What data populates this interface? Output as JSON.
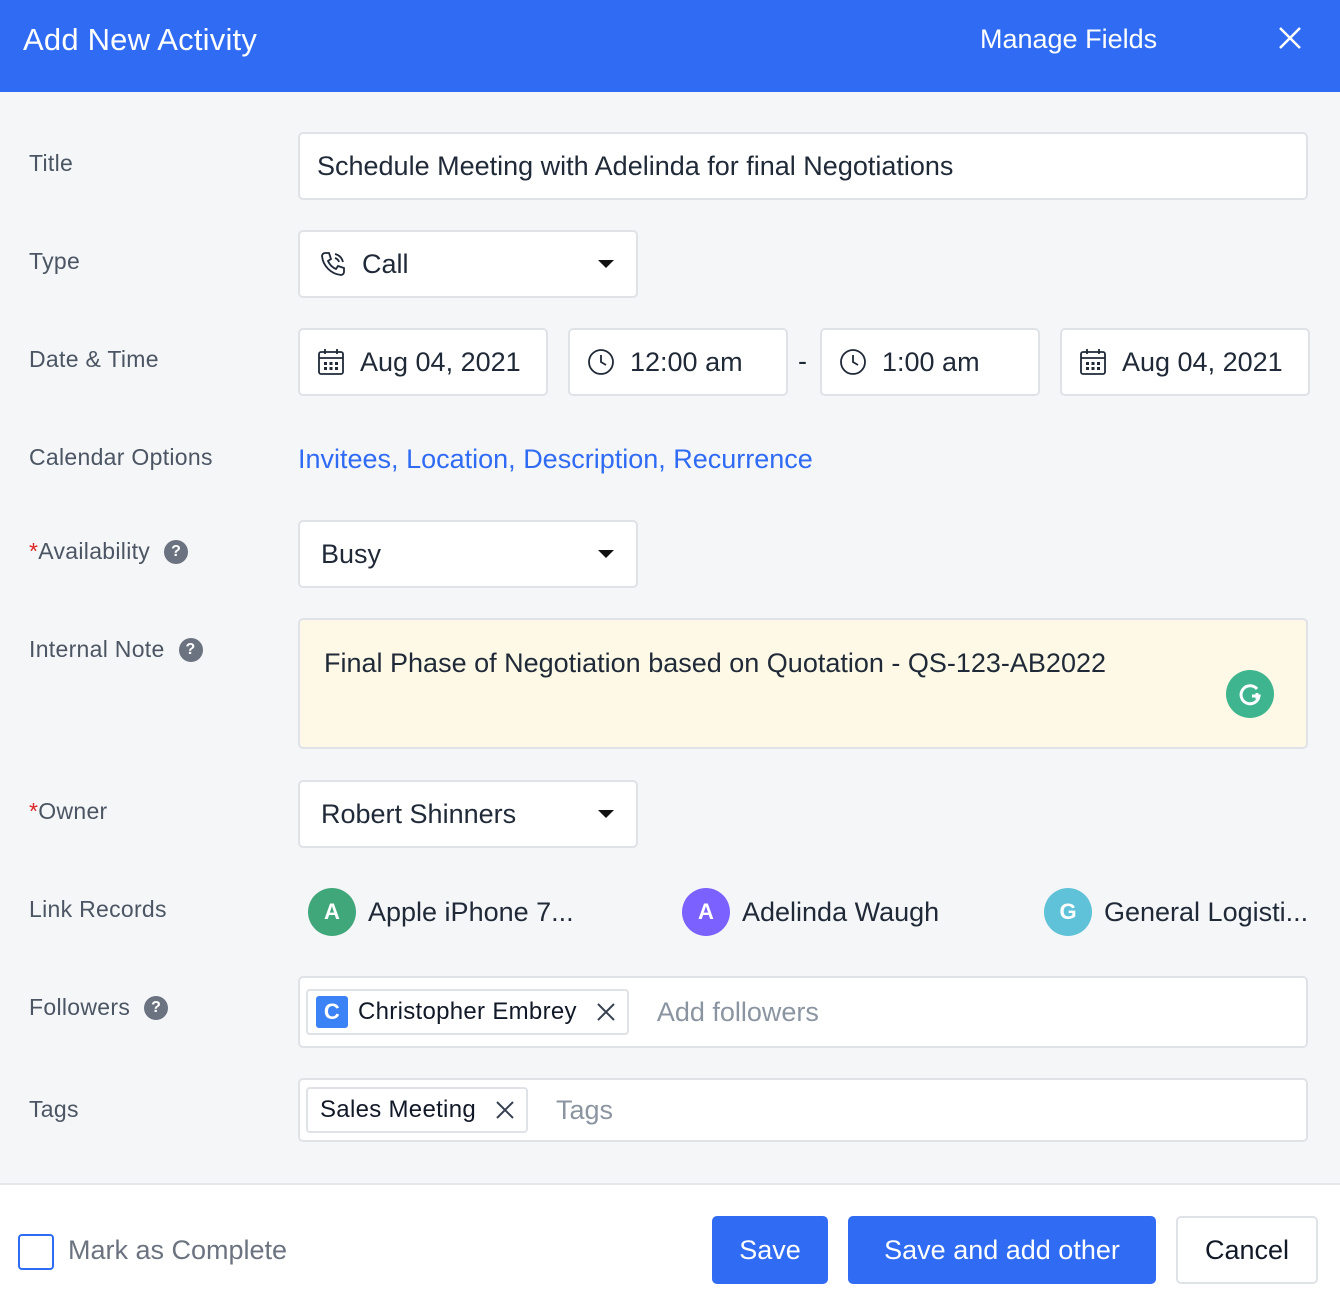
{
  "header": {
    "title": "Add New Activity",
    "manage_fields": "Manage Fields"
  },
  "form": {
    "title": {
      "label": "Title",
      "value": "Schedule Meeting with Adelinda for final Negotiations"
    },
    "type": {
      "label": "Type",
      "value": "Call"
    },
    "datetime": {
      "label": "Date & Time",
      "start_date": "Aug 04, 2021",
      "start_time": "12:00 am",
      "separator": "-",
      "end_time": "1:00 am",
      "end_date": "Aug 04, 2021"
    },
    "calendar_options": {
      "label": "Calendar Options",
      "links": [
        "Invitees,",
        "Location,",
        "Description,",
        "Recurrence"
      ]
    },
    "availability": {
      "required_mark": "*",
      "label": "Availability",
      "value": "Busy",
      "help": "?"
    },
    "internal_note": {
      "label": "Internal Note",
      "value": "Final Phase of Negotiation based on Quotation - QS-123-AB2022",
      "help": "?"
    },
    "owner": {
      "required_mark": "*",
      "label": "Owner",
      "value": "Robert Shinners"
    },
    "link_records": {
      "label": "Link Records",
      "items": [
        {
          "initial": "A",
          "name": "Apple iPhone 7...",
          "color": "#3fa77a"
        },
        {
          "initial": "A",
          "name": "Adelinda Waugh",
          "color": "#7b61ff"
        },
        {
          "initial": "G",
          "name": "General Logisti...",
          "color": "#5fc2d9"
        }
      ]
    },
    "followers": {
      "label": "Followers",
      "help": "?",
      "chip_initial": "C",
      "chip_name": "Christopher Embrey",
      "placeholder": "Add followers"
    },
    "tags": {
      "label": "Tags",
      "chip_name": "Sales Meeting",
      "placeholder": "Tags"
    }
  },
  "footer": {
    "mark_complete": "Mark as Complete",
    "save": "Save",
    "save_add_other": "Save and add other",
    "cancel": "Cancel"
  },
  "colors": {
    "accent": "#2f6bf3",
    "note_bg": "#fdf9e6",
    "required": "#dc2626"
  }
}
